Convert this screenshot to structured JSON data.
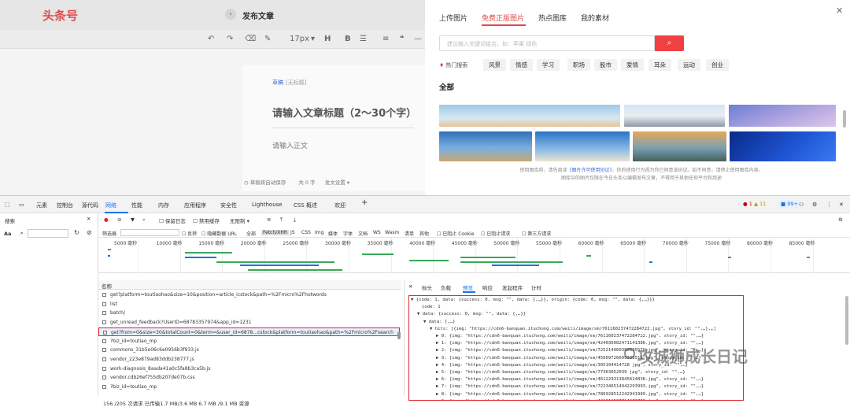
{
  "editor": {
    "logo": "头条号",
    "doc_title": "发布文章",
    "font_size": "17px",
    "tag_primary": "草稿",
    "tag_secondary": "[无标题]",
    "title_placeholder": "请输入文章标题（2～30个字）",
    "body_placeholder": "请输入正文",
    "footer_autosave": "草稿将自动保存",
    "footer_count": "共 0 字",
    "footer_settings": "发文设置"
  },
  "modal": {
    "tabs": [
      "上传图片",
      "免费正版图片",
      "热点图库",
      "我的素材"
    ],
    "active_tab": 1,
    "search_placeholder": "建议输入关键词组合，如：苹果 绿色",
    "hot_label": "热门搜索",
    "hot_tags": [
      "风景",
      "情感",
      "学习",
      "职场",
      "股市",
      "爱情",
      "耳朵",
      "运动",
      "创业"
    ],
    "section_all": "全部",
    "note_line1_a": "使用图库前，请先阅读",
    "note_link": "《图片许可使用协议》",
    "note_line1_b": "，你的使用行为视为你已同意该协议。如不同意，请停止使用图库内容。",
    "note_line2": "图库中的图片仅限在今日头条以编辑发布文章，不得用于其他任何平台和用途"
  },
  "devtools": {
    "tabs": [
      "元素",
      "控制台",
      "源代码",
      "网络",
      "性能",
      "内存",
      "应用程序",
      "安全性",
      "Lighthouse",
      "CSS 概述",
      "欢迎"
    ],
    "active_tab": "网络",
    "errors": "1",
    "warnings": "11",
    "infos": "99+",
    "search_label": "搜索",
    "search_option": "Aa",
    "network_toolbar": {
      "preserve_log": "保留日志",
      "disable_cache": "禁用缓存",
      "throttle": "无限制"
    },
    "filter": {
      "label": "筛选器",
      "invert": "反转",
      "hide_data_urls": "隐藏数据 URL",
      "types": [
        "全部",
        "Fetch/XHR",
        "JS",
        "CSS",
        "Img",
        "媒体",
        "字体",
        "文档",
        "WS",
        "Wasm",
        "清单",
        "其他"
      ],
      "active_type": "Fetch/XHR",
      "blocked_cookies": "已阻止 Cookie",
      "blocked_requests": "已阻止请求",
      "third_party": "第三方请求"
    },
    "timeline_ticks": [
      "5000 毫秒",
      "10000 毫秒",
      "15000 毫秒",
      "20000 毫秒",
      "25000 毫秒",
      "30000 毫秒",
      "35000 毫秒",
      "40000 毫秒",
      "45000 毫秒",
      "50000 毫秒",
      "55000 毫秒",
      "60000 毫秒",
      "65000 毫秒",
      "70000 毫秒",
      "75000 毫秒",
      "80000 毫秒",
      "85000 毫秒"
    ],
    "column_name": "名称",
    "requests": [
      "get?platform=toutiaohao&size=10&position=article_icstock&path=%2Fmicro%2Fhotwords",
      "list",
      "batch/",
      "get_unread_feedback?UserID=68783357974&app_id=1231",
      "get?from=0&size=30&totalCount=0&term=&user_id=6878...cstock&platform=toutiaohao&path=%2Fmicro%2Fsearch",
      "?biz_id=toutiao_mp",
      "commons_31b5e06c6e0956b3f933.js",
      "vendor_223e879ad83ddb238777.js",
      "work-diagnosis_8aada41a0c5fa8b3ca5b.js",
      "vendor.cdb26ef755db207de07b.css",
      "?biz_id=toutiao_mp"
    ],
    "highlighted_request": 4,
    "status": "156 /205 次请求  已传输1.7 MB/3.6 MB  6.7 MB /9.1 MB 资源",
    "detail_tabs": [
      "标头",
      "负载",
      "预览",
      "响应",
      "发起程序",
      "计时"
    ],
    "active_detail_tab": "预览",
    "preview_lines": [
      "▼ {code: 1, data: {success: 0, msg: \"\", data: {,…}}, origin: {code: 0, msg: \"\", data: {,…}}}",
      "code: 1",
      "▼ data: {success: 0, msg: \"\", data: {,…}}",
      "▼ data: {,…}",
      "▼ hits: [{img: \"https://cdn6-banquan.ituchong.com/weili/image/sm/761160237472284722.jpg\", story_id: \"\",…},…]",
      "▶ 0: {img: \"https://cdn6-banquan.ituchong.com/weili/image/sm/761160237472284722.jpg\", story_id: \"\",…}",
      "▶ 1: {img: \"https://cdn6-banquan.ituchong.com/weili/image/sm/424036082471141386.jpg\", story_id: \"\",…}",
      "▶ 2: {img: \"https://cdn6-banquan.ituchong.com/weili/image/sm/72521496038669557O.jpg\", story_id: \"\",…}",
      "▶ 3: {img: \"https://cdn6-banquan.ituchong.com/weili/image/sm/45609726609336515 jpg\", story_id: \"\",…}",
      "▶ 4: {img: \"https://cdn6-banquan.ituchong.com/weili/image/sm/305194414728 jpg\", story_id: \"\",…}",
      "▶ 5: {img: \"https://cdn6-banquan.ituchong.com/weili/image/sm/77363052039 jpg\", story_id: \"\",…}",
      "▶ 6: {img: \"https://cdn6-banquan.ituchong.com/weili/image/sm/461229313845624836.jpg\", story_id: \"\",…}",
      "▶ 7: {img: \"https://cdn6-banquan.ituchong.com/weili/image/sm/722346514942293993.jpg\", story_id: \"\",…}",
      "▶ 8: {img: \"https://cdn6-banquan.ituchong.com/weili/image/sm/786928512242941989.jpg\", story_id: \"\",…}",
      "▶ 9: {img: \"https://cdn6-banquan.ituchong.com/weili/image/sm/442612597714976773.jpg\", story_id: \"\",…}"
    ],
    "watermark": "攻城狮成长日记"
  },
  "colors": {
    "accent_red": "#f04142",
    "devtools_blue": "#1a73e8",
    "highlight_border": "#e0262b"
  }
}
